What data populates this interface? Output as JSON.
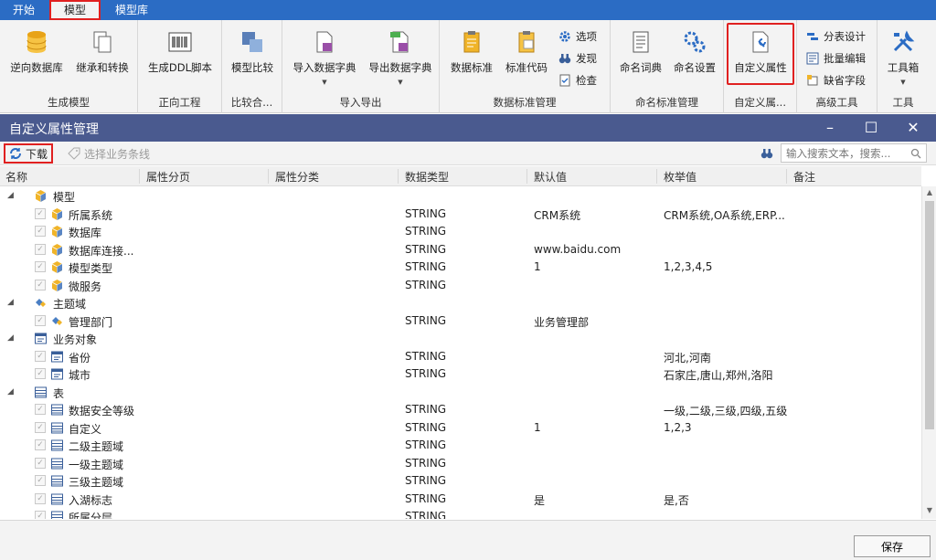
{
  "menu": {
    "tabs": [
      "开始",
      "模型",
      "模型库"
    ],
    "active": 1
  },
  "ribbon": {
    "groups": {
      "gen_model": {
        "label": "生成模型",
        "buttons": [
          "逆向数据库",
          "继承和转换"
        ]
      },
      "forward": {
        "label": "正向工程",
        "buttons": [
          "生成DDL脚本"
        ]
      },
      "compare": {
        "label": "比较合...",
        "buttons": [
          "模型比较"
        ]
      },
      "io": {
        "label": "导入导出",
        "buttons": [
          "导入数据字典",
          "导出数据字典"
        ]
      },
      "std": {
        "label": "数据标准管理",
        "buttons": [
          "数据标准",
          "标准代码"
        ],
        "small": [
          "选项",
          "发现",
          "检查"
        ]
      },
      "naming": {
        "label": "命名标准管理",
        "buttons": [
          "命名词典",
          "命名设置"
        ]
      },
      "custom": {
        "label": "自定义属...",
        "buttons": [
          "自定义属性"
        ]
      },
      "adv": {
        "label": "高级工具",
        "small": [
          "分表设计",
          "批量编辑",
          "缺省字段"
        ]
      },
      "tools": {
        "label": "工具",
        "buttons": [
          "工具箱"
        ]
      }
    }
  },
  "dialog": {
    "title": "自定义属性管理",
    "toolbar": {
      "download": "下载",
      "select_line": "选择业务条线",
      "search_placeholder": "输入搜索文本，搜索..."
    },
    "columns": [
      "名称",
      "属性分页",
      "属性分类",
      "数据类型",
      "默认值",
      "枚举值",
      "备注"
    ],
    "rows": [
      {
        "level": 0,
        "icon": "cube-icon",
        "name": "模型",
        "type": "",
        "default": "",
        "enum": ""
      },
      {
        "level": 1,
        "icon": "cube-icon",
        "name": "所属系统",
        "type": "STRING",
        "default": "CRM系统",
        "enum": "CRM系统,OA系统,ERP..."
      },
      {
        "level": 1,
        "icon": "cube-icon",
        "name": "数据库",
        "type": "STRING",
        "default": "",
        "enum": ""
      },
      {
        "level": 1,
        "icon": "cube-icon",
        "name": "数据库连接...",
        "type": "STRING",
        "default": "www.baidu.com",
        "enum": ""
      },
      {
        "level": 1,
        "icon": "cube-icon",
        "name": "模型类型",
        "type": "STRING",
        "default": "1",
        "enum": "1,2,3,4,5"
      },
      {
        "level": 1,
        "icon": "cube-icon",
        "name": "微服务",
        "type": "STRING",
        "default": "",
        "enum": ""
      },
      {
        "level": 0,
        "icon": "domain-icon",
        "name": "主题域",
        "type": "",
        "default": "",
        "enum": ""
      },
      {
        "level": 1,
        "icon": "domain-icon",
        "name": "管理部门",
        "type": "STRING",
        "default": "业务管理部",
        "enum": ""
      },
      {
        "level": 0,
        "icon": "business-object-icon",
        "name": "业务对象",
        "type": "",
        "default": "",
        "enum": ""
      },
      {
        "level": 1,
        "icon": "business-object-icon",
        "name": "省份",
        "type": "STRING",
        "default": "",
        "enum": "河北,河南"
      },
      {
        "level": 1,
        "icon": "business-object-icon",
        "name": "城市",
        "type": "STRING",
        "default": "",
        "enum": "石家庄,唐山,郑州,洛阳"
      },
      {
        "level": 0,
        "icon": "table-icon",
        "name": "表",
        "type": "",
        "default": "",
        "enum": ""
      },
      {
        "level": 1,
        "icon": "table-icon",
        "name": "数据安全等级",
        "type": "STRING",
        "default": "",
        "enum": "一级,二级,三级,四级,五级"
      },
      {
        "level": 1,
        "icon": "table-icon",
        "name": "自定义",
        "type": "STRING",
        "default": "1",
        "enum": "1,2,3"
      },
      {
        "level": 1,
        "icon": "table-icon",
        "name": "二级主题域",
        "type": "STRING",
        "default": "",
        "enum": ""
      },
      {
        "level": 1,
        "icon": "table-icon",
        "name": "一级主题域",
        "type": "STRING",
        "default": "",
        "enum": ""
      },
      {
        "level": 1,
        "icon": "table-icon",
        "name": "三级主题域",
        "type": "STRING",
        "default": "",
        "enum": ""
      },
      {
        "level": 1,
        "icon": "table-icon",
        "name": "入湖标志",
        "type": "STRING",
        "default": "是",
        "enum": "是,否"
      },
      {
        "level": 1,
        "icon": "table-icon",
        "name": "所属分层",
        "type": "STRING",
        "default": "",
        "enum": ""
      }
    ],
    "save": "保存"
  },
  "colors": {
    "menubar": "#2b6cc4",
    "titlebar": "#4a5a8f",
    "highlight": "#e02020"
  }
}
